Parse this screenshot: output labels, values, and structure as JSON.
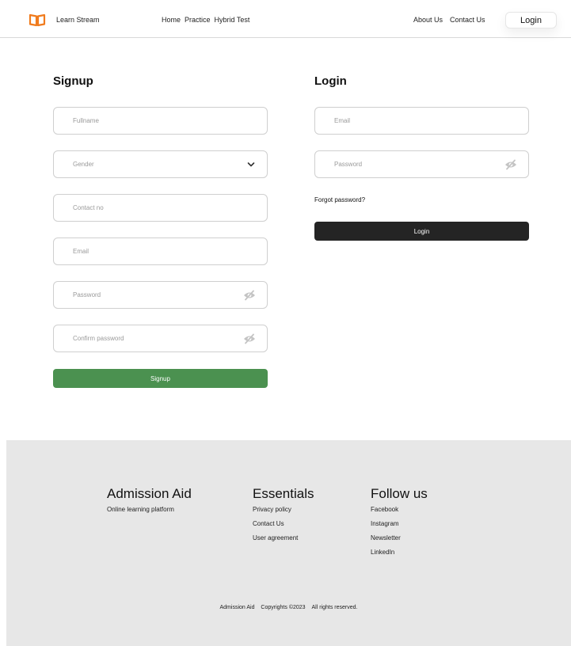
{
  "header": {
    "brand": "Learn Stream",
    "nav": [
      "Home",
      "Practice",
      "Hybrid Test"
    ],
    "right_nav": [
      "About Us",
      "Contact Us"
    ],
    "login_button": "Login",
    "logo_color": "#f07b1d"
  },
  "signup": {
    "title": "Signup",
    "fullname_placeholder": "Fullname",
    "gender_placeholder": "Gender",
    "contact_placeholder": "Contact no",
    "email_placeholder": "Email",
    "password_placeholder": "Password",
    "confirm_placeholder": "Confirm password",
    "button": "Signup",
    "button_color": "#4b9150"
  },
  "login": {
    "title": "Login",
    "email_placeholder": "Email",
    "password_placeholder": "Password",
    "forgot": "Forgot password?",
    "button": "Login",
    "button_color": "#242424"
  },
  "footer": {
    "col1": {
      "title": "Admission Aid",
      "tagline": "Online learning platform"
    },
    "col2": {
      "title": "Essentials",
      "items": [
        "Privacy policy",
        "Contact Us",
        "User agreement"
      ]
    },
    "col3": {
      "title": "Follow us",
      "items": [
        "Facebook",
        "Instagram",
        "Newsletter",
        "LinkedIn"
      ]
    },
    "copyright": [
      "Admission Aid",
      "Copyrights ©2023",
      "All rights reserved."
    ]
  }
}
